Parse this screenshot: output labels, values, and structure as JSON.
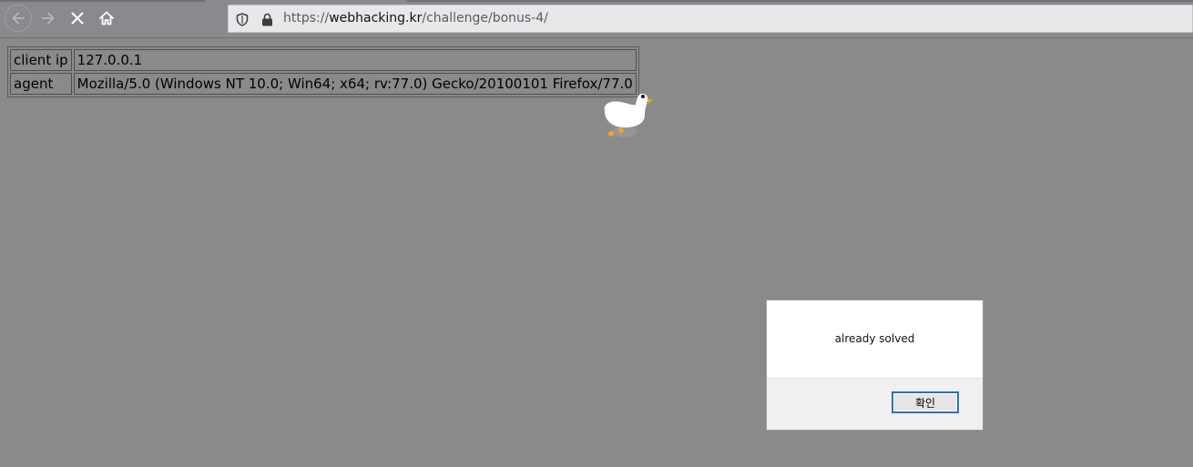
{
  "browser": {
    "url_scheme": "https://",
    "url_host": "webhacking.kr",
    "url_path": "/challenge/bonus-4/"
  },
  "icons": {
    "back": "arrow-left-icon",
    "forward": "arrow-right-icon",
    "stop": "close-icon",
    "home": "home-icon",
    "tracking": "shield-icon",
    "secure": "lock-icon",
    "goose": "goose-icon"
  },
  "info_table": {
    "rows": [
      {
        "label": "client ip",
        "value": "127.0.0.1"
      },
      {
        "label": "agent",
        "value": "Mozilla/5.0 (Windows NT 10.0; Win64; x64; rv:77.0) Gecko/20100101 Firefox/77.0"
      }
    ]
  },
  "dialog": {
    "message": "already solved",
    "ok_label": "확인"
  },
  "colors": {
    "page_background": "#8a8a8a",
    "dialog_focus": "#2b6fc6"
  }
}
